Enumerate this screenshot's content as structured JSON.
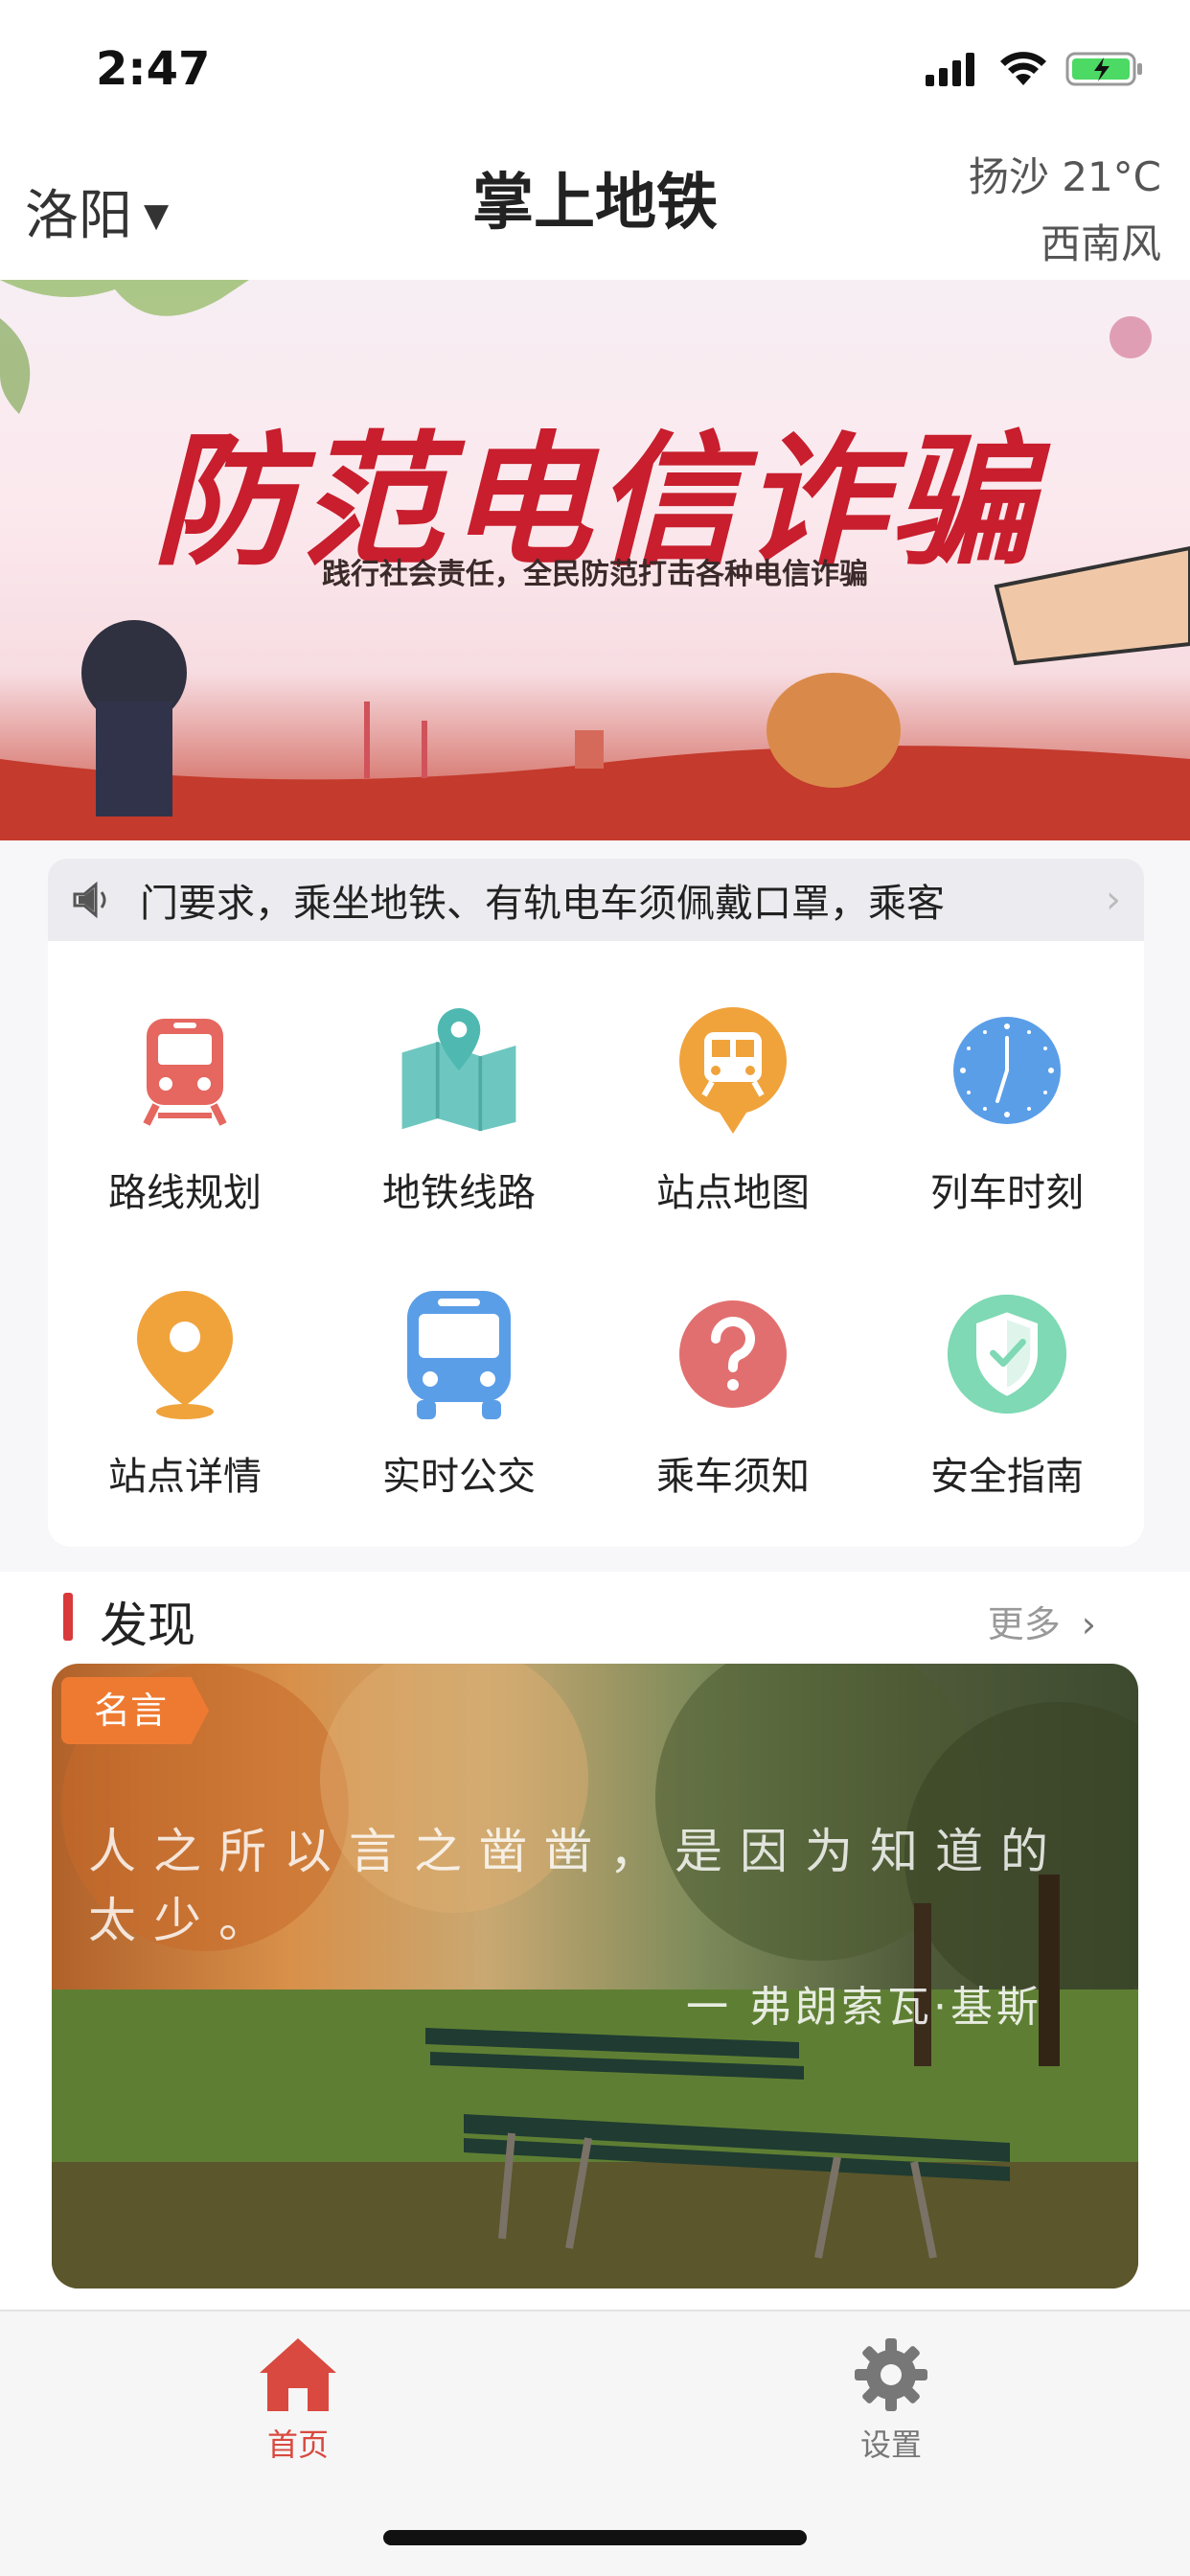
{
  "status_bar": {
    "time": "2:47"
  },
  "header": {
    "city": "洛阳",
    "title": "掌上地铁",
    "weather_line1": "扬沙 21°C",
    "weather_line2": "西南风"
  },
  "banner": {
    "title": "防范电信诈骗",
    "subtitle": "践行社会责任，全民防范打击各种电信诈骗"
  },
  "notice": {
    "text": "门要求，乘坐地铁、有轨电车须佩戴口罩，乘客"
  },
  "grid": {
    "items": [
      {
        "label": "路线规划",
        "icon": "train-icon",
        "color": "#e5675f"
      },
      {
        "label": "地铁线路",
        "icon": "map-icon",
        "color": "#6dc7c0"
      },
      {
        "label": "站点地图",
        "icon": "station-map-icon",
        "color": "#f0a33b"
      },
      {
        "label": "列车时刻",
        "icon": "clock-icon",
        "color": "#5b9ee8"
      },
      {
        "label": "站点详情",
        "icon": "location-pin-icon",
        "color": "#f0a33b"
      },
      {
        "label": "实时公交",
        "icon": "bus-icon",
        "color": "#5b9ee8"
      },
      {
        "label": "乘车须知",
        "icon": "question-icon",
        "color": "#e26f6f"
      },
      {
        "label": "安全指南",
        "icon": "shield-check-icon",
        "color": "#7ed9b4"
      }
    ]
  },
  "discover": {
    "title": "发现",
    "more": "更多",
    "quote": {
      "tag": "名言",
      "text": "人之所以言之凿凿，是因为知道的太少。",
      "author": "一 弗朗索瓦·基斯"
    }
  },
  "tabbar": {
    "home_label": "首页",
    "settings_label": "设置",
    "active_color": "#d9493f"
  }
}
